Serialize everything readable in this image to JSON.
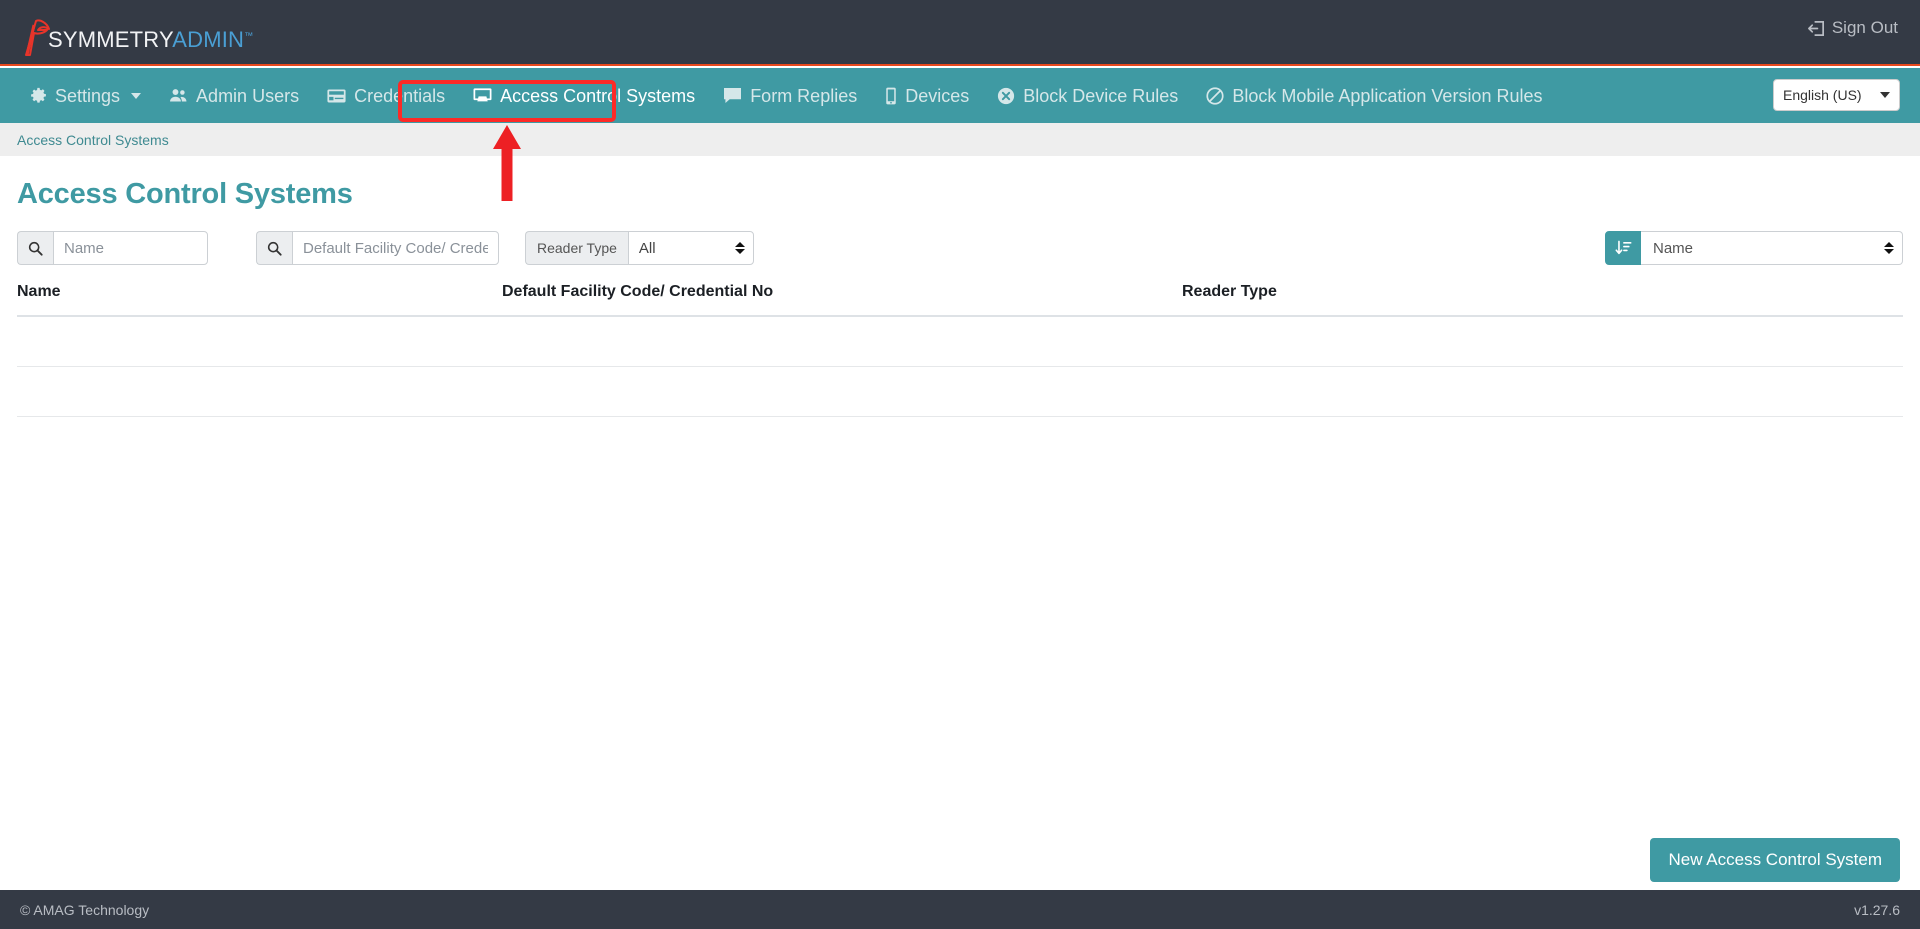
{
  "brand": {
    "name_primary": "SYMMETRY",
    "name_secondary": "ADMIN",
    "trademark": "™",
    "logo_icon": "eagle-logo-icon",
    "accent_color": "#3f9aa3",
    "dark_color": "#343a45",
    "red_color": "#e8491d"
  },
  "topbar": {
    "signout_label": "Sign Out",
    "signout_icon": "sign-out-icon"
  },
  "nav": {
    "items": [
      {
        "label": "Settings",
        "icon": "gear-icon",
        "active": false,
        "has_caret": true
      },
      {
        "label": "Admin Users",
        "icon": "users-icon",
        "active": false,
        "has_caret": false
      },
      {
        "label": "Credentials",
        "icon": "card-icon",
        "active": false,
        "has_caret": false
      },
      {
        "label": "Access Control Systems",
        "icon": "monitor-icon",
        "active": true,
        "has_caret": false
      },
      {
        "label": "Form Replies",
        "icon": "comment-icon",
        "active": false,
        "has_caret": false
      },
      {
        "label": "Devices",
        "icon": "mobile-icon",
        "active": false,
        "has_caret": false
      },
      {
        "label": "Block Device Rules",
        "icon": "times-circle-icon",
        "active": false,
        "has_caret": false
      },
      {
        "label": "Block Mobile Application Version Rules",
        "icon": "ban-icon",
        "active": false,
        "has_caret": false
      }
    ],
    "language_selected": "English (US)",
    "language_options": [
      "English (US)"
    ]
  },
  "breadcrumb": {
    "items": [
      "Access Control Systems"
    ]
  },
  "page": {
    "title": "Access Control Systems"
  },
  "filters": {
    "name_search": {
      "value": "",
      "placeholder": "Name",
      "icon": "search-icon"
    },
    "facility_search": {
      "value": "",
      "placeholder": "Default Facility Code/ Credential No",
      "icon": "search-icon"
    },
    "reader_type": {
      "label": "Reader Type",
      "selected": "All",
      "options": [
        "All"
      ]
    }
  },
  "sort": {
    "icon": "sort-amount-desc-icon",
    "selected": "Name",
    "options": [
      "Name"
    ]
  },
  "table": {
    "columns": [
      "Name",
      "Default Facility Code/ Credential No",
      "Reader Type"
    ],
    "rows": []
  },
  "actions": {
    "new_access_control_system": "New Access Control System"
  },
  "footer": {
    "copyright": "© AMAG Technology",
    "version": "v1.27.6"
  },
  "annotation": {
    "highlight_target": "Access Control Systems",
    "color": "#fc2a27"
  }
}
